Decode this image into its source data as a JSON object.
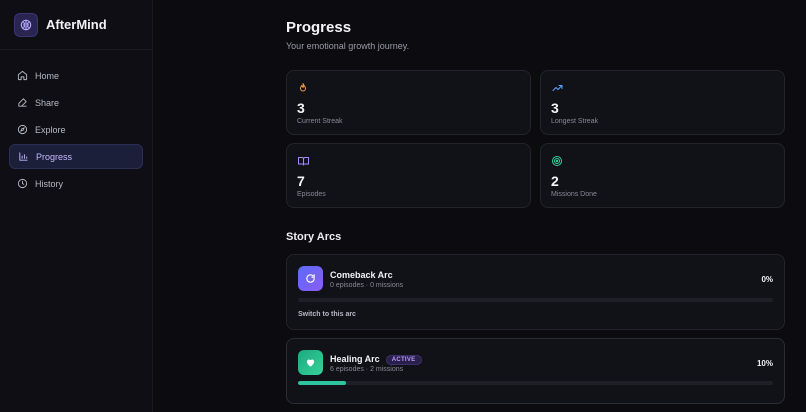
{
  "brand": {
    "name": "AfterMind",
    "logo_icon": "brain-icon"
  },
  "sidebar": {
    "items": [
      {
        "label": "Home",
        "icon": "home-icon",
        "active": false
      },
      {
        "label": "Share",
        "icon": "pen-icon",
        "active": false
      },
      {
        "label": "Explore",
        "icon": "compass-icon",
        "active": false
      },
      {
        "label": "Progress",
        "icon": "bar-chart-icon",
        "active": true
      },
      {
        "label": "History",
        "icon": "clock-icon",
        "active": false
      }
    ]
  },
  "page": {
    "title": "Progress",
    "subtitle": "Your emotional growth journey."
  },
  "stats": [
    {
      "value": "3",
      "label": "Current Streak",
      "icon": "flame-icon",
      "color": "#f59e42"
    },
    {
      "value": "3",
      "label": "Longest Streak",
      "icon": "trending-up-icon",
      "color": "#60a5fa"
    },
    {
      "value": "7",
      "label": "Episodes",
      "icon": "book-open-icon",
      "color": "#a78bfa"
    },
    {
      "value": "2",
      "label": "Missions Done",
      "icon": "target-icon",
      "color": "#34d399"
    }
  ],
  "story_arcs": {
    "title": "Story Arcs",
    "arcs": [
      {
        "name": "Comeback Arc",
        "meta": "0 episodes · 0 missions",
        "percent_label": "0%",
        "progress": 0,
        "switch_label": "Switch to this arc",
        "badge": "",
        "color": "#6d6cf0"
      },
      {
        "name": "Healing Arc",
        "meta": "6 episodes · 2 missions",
        "percent_label": "10%",
        "progress": 0.1,
        "switch_label": "",
        "badge": "ACTIVE",
        "color": "#2ec4a0"
      }
    ]
  },
  "colors": {
    "accent": "#a78bfa",
    "background": "#0b0b10",
    "card": "#111118"
  }
}
